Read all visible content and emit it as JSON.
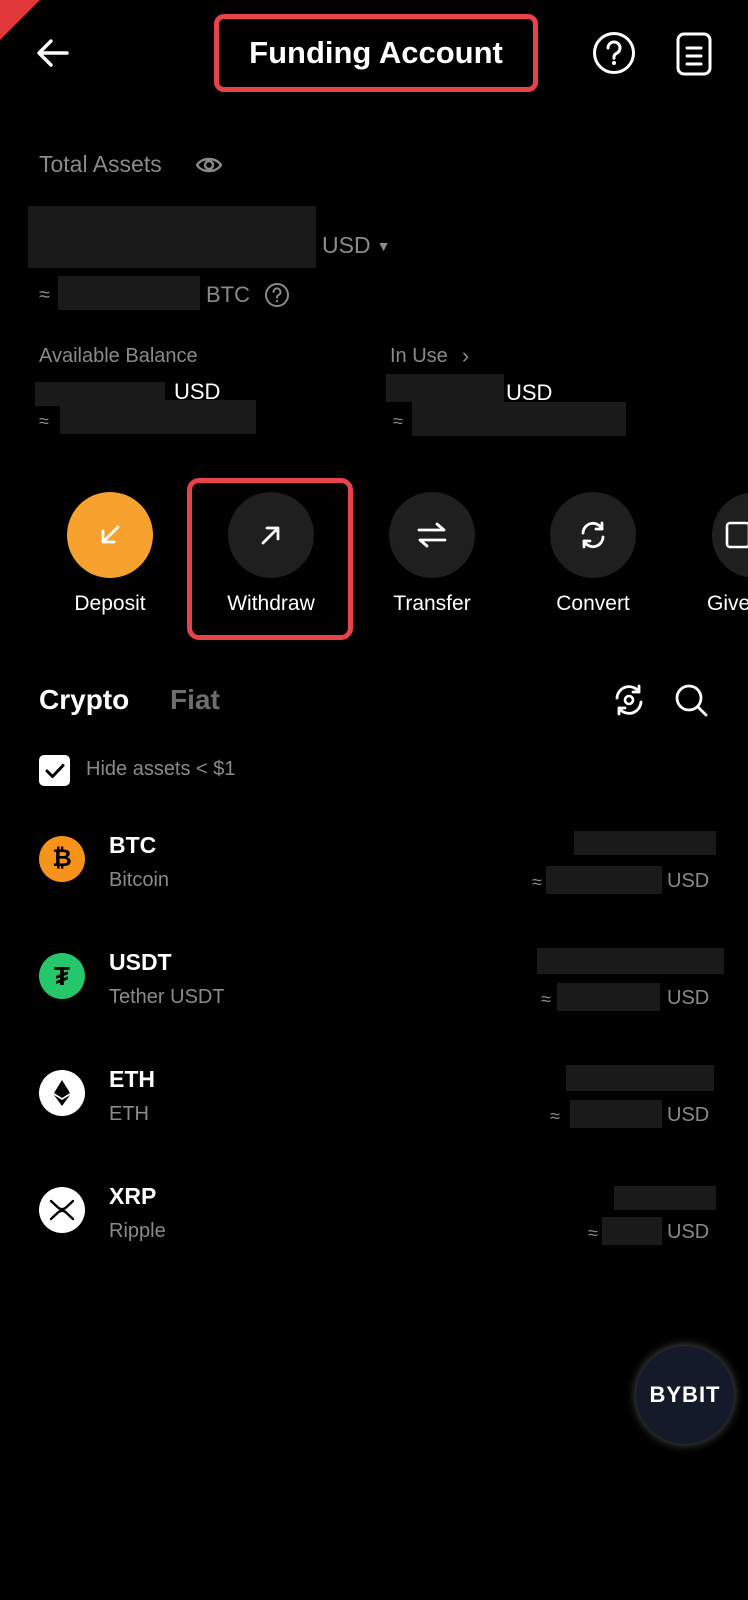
{
  "header": {
    "title": "Funding Account"
  },
  "total_assets": {
    "label": "Total Assets",
    "currency": "USD",
    "approx": "≈",
    "btc_unit": "BTC"
  },
  "balances": {
    "available": {
      "label": "Available Balance",
      "currency": "USD",
      "approx": "≈"
    },
    "in_use": {
      "label": "In Use",
      "currency": "USD",
      "approx": "≈"
    }
  },
  "actions": [
    {
      "label": "Deposit"
    },
    {
      "label": "Withdraw"
    },
    {
      "label": "Transfer"
    },
    {
      "label": "Convert"
    },
    {
      "label": "Give"
    }
  ],
  "tabs": [
    {
      "label": "Crypto"
    },
    {
      "label": "Fiat"
    }
  ],
  "filter": {
    "label": "Hide assets < $1",
    "checked": true
  },
  "assets": [
    {
      "symbol": "BTC",
      "name": "Bitcoin",
      "approx": "≈",
      "currency": "USD",
      "color": "#f7931a"
    },
    {
      "symbol": "USDT",
      "name": "Tether USDT",
      "approx": "≈",
      "currency": "USD",
      "color": "#26c76a"
    },
    {
      "symbol": "ETH",
      "name": "ETH",
      "approx": "≈",
      "currency": "USD",
      "color": "#ffffff"
    },
    {
      "symbol": "XRP",
      "name": "Ripple",
      "approx": "≈",
      "currency": "USD",
      "color": "#ffffff"
    }
  ],
  "brand": {
    "logo_text": "BYBIT"
  }
}
